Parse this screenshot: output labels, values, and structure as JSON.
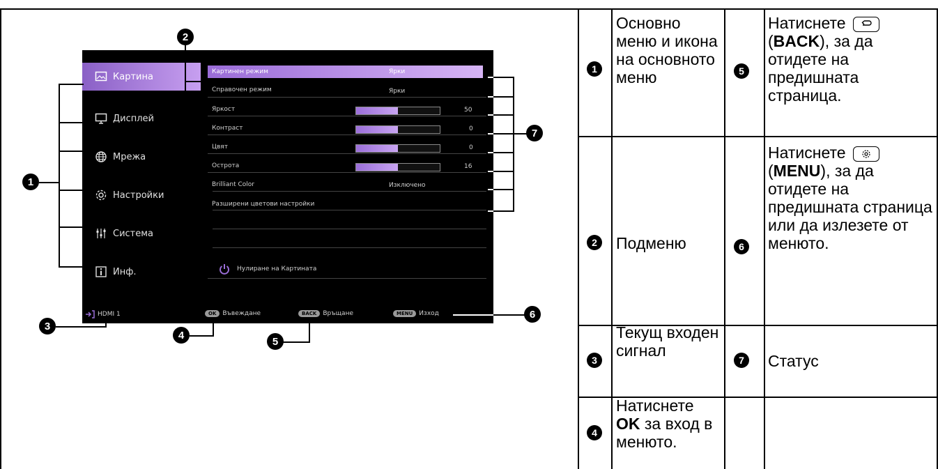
{
  "osd": {
    "menu": [
      {
        "label": "Картина",
        "icon": "picture-icon",
        "active": true
      },
      {
        "label": "Дисплей",
        "icon": "monitor-icon",
        "active": false
      },
      {
        "label": "Мрежа",
        "icon": "globe-icon",
        "active": false
      },
      {
        "label": "Настройки",
        "icon": "gear-icon",
        "active": false
      },
      {
        "label": "Система",
        "icon": "sliders-icon",
        "active": false
      },
      {
        "label": "Инф.",
        "icon": "info-icon",
        "active": false
      }
    ],
    "submenu": [
      {
        "label": "Картинен режим",
        "value": "Ярки"
      },
      {
        "label": "Справочен режим",
        "value": "Ярки"
      },
      {
        "label": "Яркост",
        "value": "50",
        "level": 0.5
      },
      {
        "label": "Контраст",
        "value": "0",
        "level": 0.5
      },
      {
        "label": "Цвят",
        "value": "0",
        "level": 0.5
      },
      {
        "label": "Острота",
        "value": "16",
        "level": 0.5
      },
      {
        "label": "Brilliant Color",
        "value": "Изключено"
      },
      {
        "label": "Разширени цветови настройки",
        "value": ""
      }
    ],
    "reset_label": "Нулиране на Картината",
    "input_source": "HDMI 1",
    "footer": {
      "ok_key": "OK",
      "ok_label": "Въвеждане",
      "back_key": "BACK",
      "back_label": "Връщане",
      "menu_key": "MENU",
      "menu_label": "Изход"
    }
  },
  "callouts": [
    "1",
    "2",
    "3",
    "4",
    "5",
    "6",
    "7"
  ],
  "legend": {
    "items": [
      {
        "num": "1",
        "text": "Основно меню и икона на основното меню"
      },
      {
        "num": "2",
        "text": "Подменю"
      },
      {
        "num": "3",
        "text": "Текущ входен сигнал"
      },
      {
        "num": "4",
        "text_before": "Натиснете ",
        "bold": "OK",
        "text_after": " за вход в менюто."
      },
      {
        "num": "5",
        "text_before": "Натиснете ",
        "paren_open": "(",
        "bold": "BACK",
        "text_after": "), за да отидете на предишната страница."
      },
      {
        "num": "6",
        "text_before": "Натиснете ",
        "paren_open": "(",
        "bold": "MENU",
        "text_after": "), за да отидете на предишната страница или да излезете от менюто."
      },
      {
        "num": "7",
        "text": "Статус"
      }
    ]
  },
  "colors": {
    "accent": "#9b6fd9",
    "osd_bg": "#000000"
  }
}
